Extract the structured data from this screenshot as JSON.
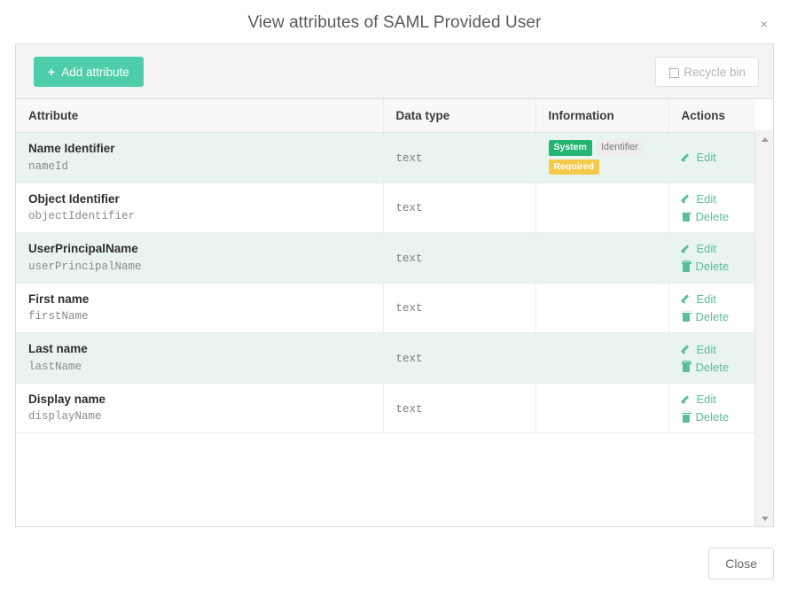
{
  "dialog": {
    "title": "View attributes of SAML Provided User",
    "close_x": "×"
  },
  "toolbar": {
    "add_label": "Add attribute",
    "add_plus": "+",
    "add_color": "#4ecdaa",
    "recycle_label": "Recycle bin",
    "recycle_enabled": false
  },
  "table": {
    "columns": [
      "Attribute",
      "Data type",
      "Information",
      "Actions"
    ],
    "rows": [
      {
        "name": "Name Identifier",
        "key": "nameId",
        "type": "text",
        "badges": [
          {
            "label": "System",
            "style": "system",
            "color": "#22b573"
          },
          {
            "label": "Identifier",
            "style": "neutral",
            "color": "#ededed"
          },
          {
            "label": "Required",
            "style": "required",
            "color": "#f5ca49"
          }
        ],
        "actions": [
          "Edit"
        ]
      },
      {
        "name": "Object Identifier",
        "key": "objectIdentifier",
        "type": "text",
        "badges": [],
        "actions": [
          "Edit",
          "Delete"
        ]
      },
      {
        "name": "UserPrincipalName",
        "key": "userPrincipalName",
        "type": "text",
        "badges": [],
        "actions": [
          "Edit",
          "Delete"
        ]
      },
      {
        "name": "First name",
        "key": "firstName",
        "type": "text",
        "badges": [],
        "actions": [
          "Edit",
          "Delete"
        ]
      },
      {
        "name": "Last name",
        "key": "lastName",
        "type": "text",
        "badges": [],
        "actions": [
          "Edit",
          "Delete"
        ]
      },
      {
        "name": "Display name",
        "key": "displayName",
        "type": "text",
        "badges": [],
        "actions": [
          "Edit",
          "Delete"
        ]
      }
    ]
  },
  "footer": {
    "close_label": "Close"
  }
}
